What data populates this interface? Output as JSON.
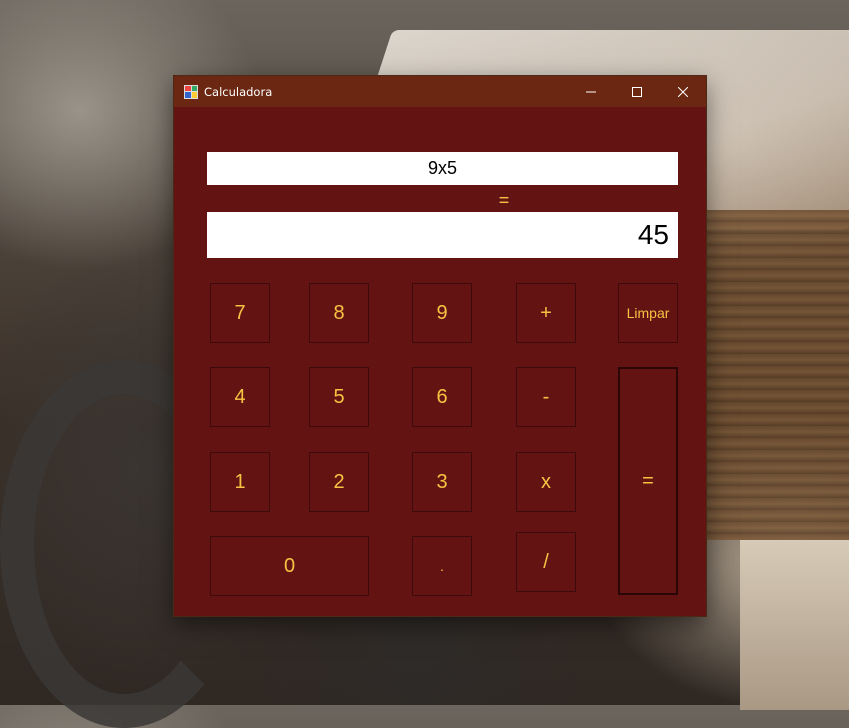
{
  "window": {
    "title": "Calculadora",
    "controls": {
      "minimize": "minimize",
      "maximize": "maximize",
      "close": "close"
    }
  },
  "display": {
    "expression": "9x5",
    "equals_sign": "=",
    "result": "45"
  },
  "keys": {
    "k7": "7",
    "k8": "8",
    "k9": "9",
    "plus": "+",
    "clear": "Limpar",
    "k4": "4",
    "k5": "5",
    "k6": "6",
    "minus": "-",
    "k1": "1",
    "k2": "2",
    "k3": "3",
    "times": "x",
    "k0": "0",
    "dot": ".",
    "divide": "/",
    "equals": "="
  },
  "colors": {
    "window_bg": "#641313",
    "titlebar_bg": "#6b2712",
    "key_text": "#f6c343"
  }
}
